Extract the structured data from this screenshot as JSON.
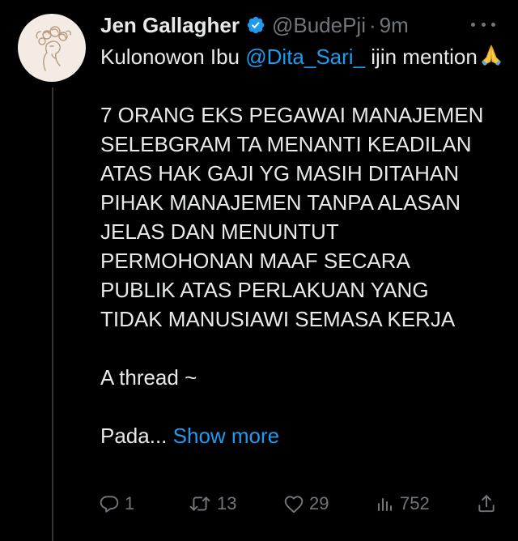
{
  "tweet": {
    "author_name": "Jen Gallagher",
    "handle": "@BudePji",
    "separator": "·",
    "time": "9m",
    "text_intro": "Kulonowon Ibu ",
    "mention": "@Dita_Sari_",
    "text_after_mention": " ijin mention",
    "emoji": "folded-hands-emoji",
    "body_lines": [
      "7 ORANG EKS PEGAWAI MANAJEMEN",
      "SELEBGRAM TA MENANTI KEADILAN",
      "ATAS HAK GAJI YG MASIH DITAHAN",
      "PIHAK MANAJEMEN TANPA ALASAN",
      "JELAS DAN MENUNTUT",
      "PERMOHONAN MAAF SECARA",
      "PUBLIK ATAS PERLAKUAN YANG",
      "TIDAK MANUSIAWI SEMASA KERJA"
    ],
    "thread_text": "A thread ~",
    "truncated_text": "Pada...",
    "show_more_label": "Show more"
  },
  "actions": {
    "replies": "1",
    "retweets": "13",
    "likes": "29",
    "views": "752"
  },
  "colors": {
    "background": "#000000",
    "text": "#e7e9ea",
    "secondary": "#71767b",
    "link": "#1d9bf0",
    "verified": "#1d9bf0"
  }
}
